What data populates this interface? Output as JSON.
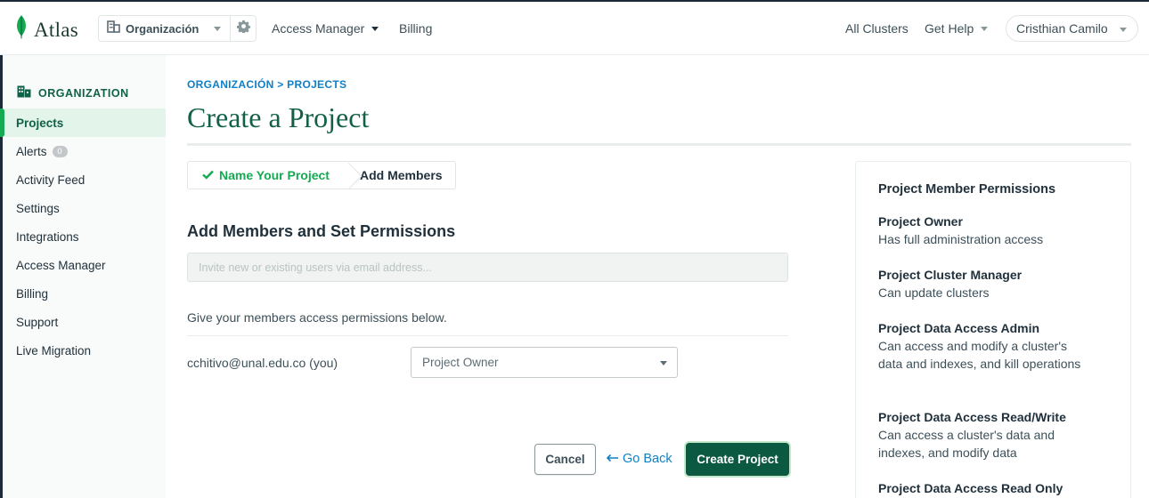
{
  "app": {
    "logo_text": "Atlas",
    "brand_color": "#13aa52",
    "dark_green": "#116149"
  },
  "topbar": {
    "org_name": "Organización",
    "nav": [
      "Access Manager",
      "Billing"
    ],
    "right_links": [
      "All Clusters",
      "Get Help"
    ],
    "user": "Cristhian Camilo"
  },
  "sidebar": {
    "heading": "ORGANIZATION",
    "items": [
      {
        "label": "Projects",
        "active": true
      },
      {
        "label": "Alerts",
        "badge": "0"
      },
      {
        "label": "Activity Feed"
      },
      {
        "label": "Settings"
      },
      {
        "label": "Integrations"
      },
      {
        "label": "Access Manager"
      },
      {
        "label": "Billing"
      },
      {
        "label": "Support"
      },
      {
        "label": "Live Migration"
      }
    ]
  },
  "main": {
    "breadcrumb": "ORGANIZACIÓN > PROJECTS",
    "title": "Create a Project",
    "steps": [
      {
        "label": "Name Your Project",
        "status": "done"
      },
      {
        "label": "Add Members",
        "status": "current"
      }
    ],
    "section_heading": "Add Members and Set Permissions",
    "invite_placeholder": "Invite new or existing users via email address...",
    "give_text": "Give your members access permissions below.",
    "member": {
      "email": "cchitivo@unal.edu.co (you)",
      "role": "Project Owner"
    },
    "buttons": {
      "cancel": "Cancel",
      "go_back": "Go Back",
      "create": "Create Project"
    }
  },
  "permissions": {
    "title": "Project Member Permissions",
    "items": [
      {
        "name": "Project Owner",
        "desc": "Has full administration access"
      },
      {
        "name": "Project Cluster Manager",
        "desc": "Can update clusters"
      },
      {
        "name": "Project Data Access Admin",
        "desc": "Can access and modify a cluster's data and indexes, and kill operations"
      },
      {
        "name": "Project Data Access Read/Write",
        "desc": "Can access a cluster's data and indexes, and modify data"
      },
      {
        "name": "Project Data Access Read Only",
        "desc": ""
      }
    ]
  }
}
